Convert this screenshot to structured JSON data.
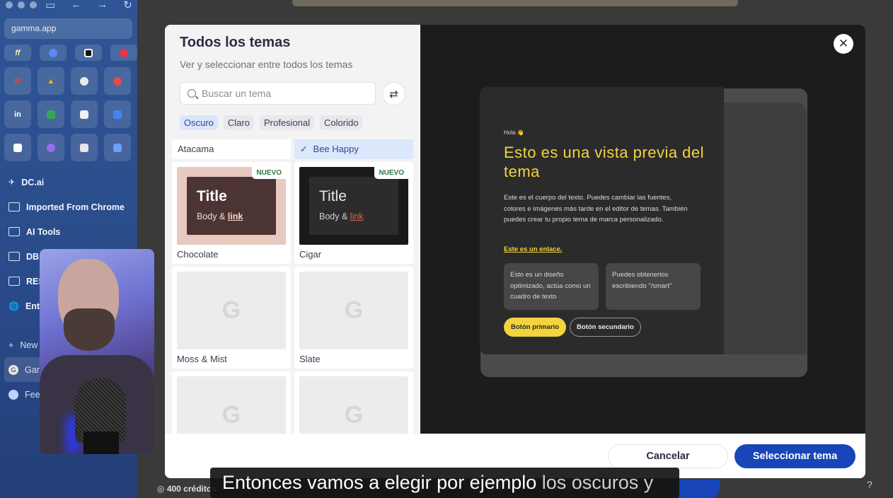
{
  "browser": {
    "url": "gamma.app",
    "folders": [
      {
        "label": "DC.ai",
        "icon": "dc-ai-icon"
      },
      {
        "label": "Imported From Chrome",
        "icon": "folder-icon"
      },
      {
        "label": "AI Tools",
        "icon": "folder-icon"
      },
      {
        "label": "DB",
        "icon": "folder-icon"
      },
      {
        "label": "RES",
        "icon": "folder-icon"
      },
      {
        "label": "Ent",
        "icon": "globe-icon"
      }
    ],
    "lower_items": [
      {
        "label": "New",
        "icon": "plus-icon"
      },
      {
        "label": "Gam",
        "icon": "gamma-icon"
      },
      {
        "label": "Fee",
        "icon": "feedback-icon"
      }
    ]
  },
  "modal": {
    "title": "Todos los temas",
    "subtitle": "Ver y seleccionar entre todos los temas",
    "search_placeholder": "Buscar un tema",
    "filters": [
      "Oscuro",
      "Claro",
      "Profesional",
      "Colorido"
    ],
    "top_row": [
      {
        "name": "Atacama",
        "selected": false
      },
      {
        "name": "Bee Happy",
        "selected": true
      }
    ],
    "themes": [
      {
        "name": "Chocolate",
        "badge": "NUEVO",
        "thumb_title": "Title",
        "thumb_body": "Body &",
        "thumb_link": "link"
      },
      {
        "name": "Cigar",
        "badge": "NUEVO",
        "thumb_title": "Title",
        "thumb_body": "Body &",
        "thumb_link": "link"
      },
      {
        "name": "Moss & Mist",
        "badge": "",
        "thumb_title": "",
        "thumb_body": "",
        "thumb_link": ""
      },
      {
        "name": "Slate",
        "badge": "",
        "thumb_title": "",
        "thumb_body": "",
        "thumb_link": ""
      }
    ],
    "cancel_label": "Cancelar",
    "select_label": "Seleccionar tema"
  },
  "preview": {
    "greeting": "Hola 👋",
    "title": "Esto es una vista previa del tema",
    "body": "Este es el cuerpo del texto. Puedes cambiar las fuentes, colores e imágenes más tarde en el editor de temas. También puedes crear tu propio tema de marca personalizado.",
    "link": "Este es un enlace.",
    "box1": "Esto es un diseño optimizado, actúa como un cuadro de texto",
    "box2": "Puedes obtenerlos escribiendo \"/smart\"",
    "primary_button": "Botón primario",
    "secondary_button": "Botón secundario"
  },
  "bottom": {
    "credits": "400 créditos",
    "help": "?"
  },
  "caption": {
    "bright": "Entonces vamos a elegir por ejemplo",
    "dim": "los oscuros y"
  },
  "colors": {
    "accent": "#1846b8",
    "preview_yellow": "#f3d33e",
    "chocolate_bg": "#e8c9c0",
    "chocolate_inner": "#4d3434",
    "cigar_bg": "#1a1a1a",
    "cigar_inner": "#2c2c2c"
  }
}
